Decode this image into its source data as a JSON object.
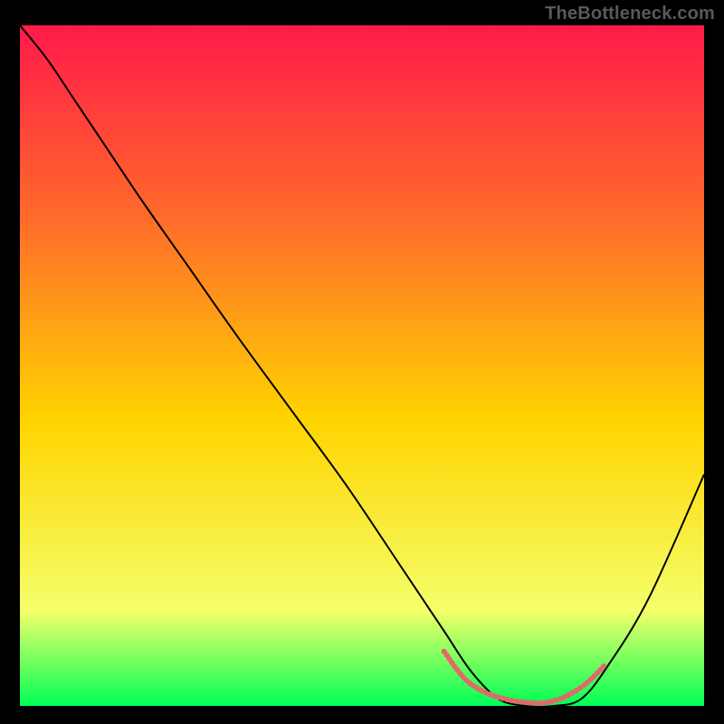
{
  "watermark": "TheBottleneck.com",
  "chart_data": {
    "type": "line",
    "title": "",
    "xlabel": "",
    "ylabel": "",
    "xlim": [
      0,
      100
    ],
    "ylim": [
      0,
      100
    ],
    "background_gradient": {
      "top": "#ff1a4a",
      "upper_mid": "#ff6a2a",
      "mid": "#ffd400",
      "lower_mid": "#f4ff6a",
      "bottom": "#00ff55"
    },
    "series": [
      {
        "name": "bottleneck-curve",
        "color": "#000000",
        "stroke_width": 2,
        "x": [
          0,
          4,
          8,
          12,
          18,
          25,
          32,
          40,
          48,
          56,
          62,
          66,
          70,
          74,
          78,
          82,
          86,
          92,
          100
        ],
        "y": [
          100,
          95,
          89,
          83,
          74,
          64,
          54,
          43,
          32,
          20,
          11,
          5,
          1,
          0,
          0,
          1,
          6,
          16,
          34
        ]
      },
      {
        "name": "optimal-band",
        "color": "#e06a6a",
        "stroke_width": 6,
        "dash": "0.8 4.2",
        "x": [
          62,
          65,
          68,
          71,
          74,
          77,
          80,
          83,
          85.5
        ],
        "y": [
          8,
          4,
          2,
          1,
          0.5,
          0.5,
          1.5,
          3.5,
          6
        ]
      }
    ]
  }
}
